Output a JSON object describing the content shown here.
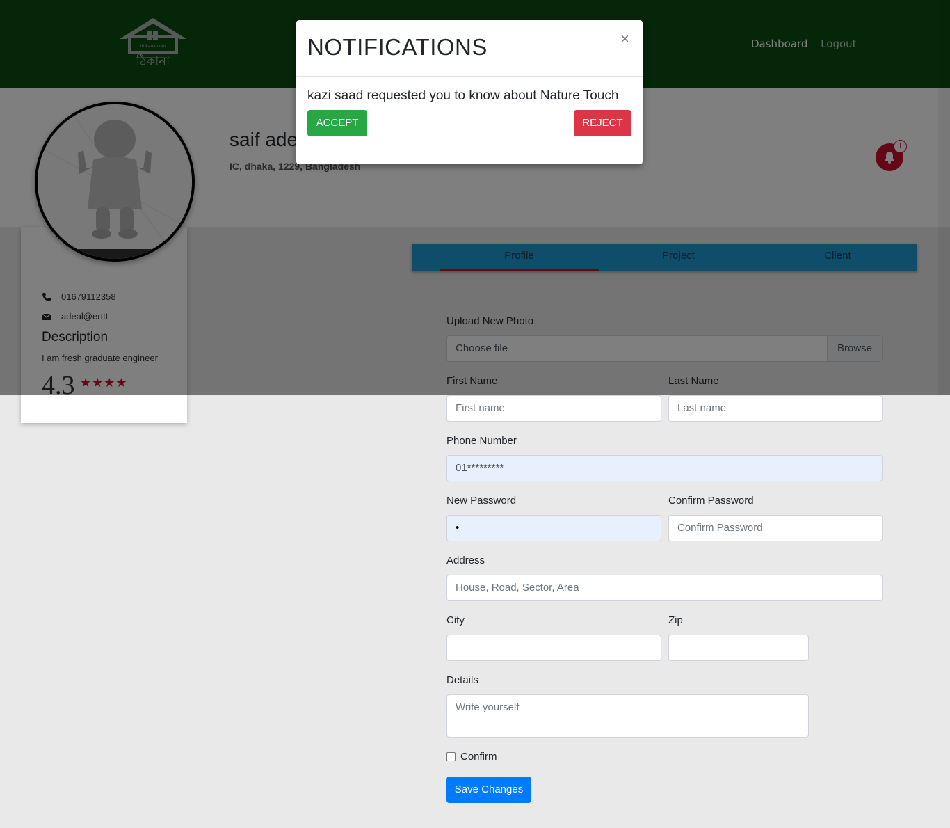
{
  "header": {
    "logo_text": "ঠিকানা",
    "logo_small": "thikana.com",
    "nav": {
      "dashboard": "Dashboard",
      "logout": "Logout"
    }
  },
  "profile": {
    "name": "saif adel",
    "address": "IC, dhaka, 1229, Bangladesh",
    "phone": "01679112358",
    "email": "adeal@erttt",
    "description_title": "Description",
    "description": "I am fresh graduate engineer",
    "rating": "4.3",
    "stars": "★★★★",
    "notification_count": "1"
  },
  "tabs": [
    {
      "label": "Profile",
      "active": true
    },
    {
      "label": "Project",
      "active": false
    },
    {
      "label": "Client",
      "active": false
    }
  ],
  "form": {
    "upload_label": "Upload New Photo",
    "file_placeholder": "Choose file",
    "browse_label": "Browse",
    "first_name_label": "First Name",
    "first_name_placeholder": "First name",
    "last_name_label": "Last Name",
    "last_name_placeholder": "Last name",
    "phone_label": "Phone Number",
    "phone_value": "01*********",
    "new_password_label": "New Password",
    "new_password_value": "•",
    "confirm_password_label": "Confirm Password",
    "confirm_password_placeholder": "Confirm Password",
    "address_label": "Address",
    "address_placeholder": "House, Road, Sector, Area",
    "city_label": "City",
    "zip_label": "Zip",
    "details_label": "Details",
    "details_placeholder": "Write yourself",
    "confirm_label": "Confirm",
    "save_label": "Save Changes"
  },
  "modal": {
    "title": "NOTIFICATIONS",
    "close": "×",
    "message": "kazi saad requested you to know about Nature Touch",
    "accept": "ACCEPT",
    "reject": "REJECT"
  },
  "colors": {
    "header": "#0c4d12",
    "tabs": "#1e9bd7",
    "accent_red": "#c8102e",
    "accept": "#28a745",
    "reject": "#dc3545",
    "primary": "#007bff"
  }
}
